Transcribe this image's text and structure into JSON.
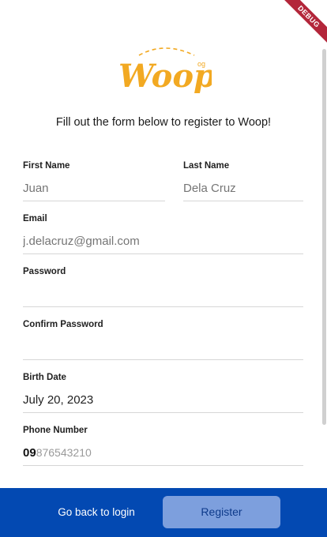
{
  "debug_banner": "DEBUG",
  "logo": {
    "text": "Woop!",
    "suffix": "og",
    "color": "#f2a922"
  },
  "subtitle": "Fill out the form below to register to Woop!",
  "form": {
    "first_name": {
      "label": "First Name",
      "placeholder": "Juan"
    },
    "last_name": {
      "label": "Last Name",
      "placeholder": "Dela Cruz"
    },
    "email": {
      "label": "Email",
      "placeholder": "j.delacruz@gmail.com"
    },
    "password": {
      "label": "Password",
      "value": ""
    },
    "confirm_password": {
      "label": "Confirm Password",
      "value": ""
    },
    "birth_date": {
      "label": "Birth Date",
      "value": "July 20, 2023"
    },
    "phone": {
      "label": "Phone Number",
      "prefix": "09",
      "placeholder": "876543210"
    }
  },
  "footer": {
    "back_label": "Go back to login",
    "register_label": "Register",
    "bar_color": "#0349b2"
  }
}
